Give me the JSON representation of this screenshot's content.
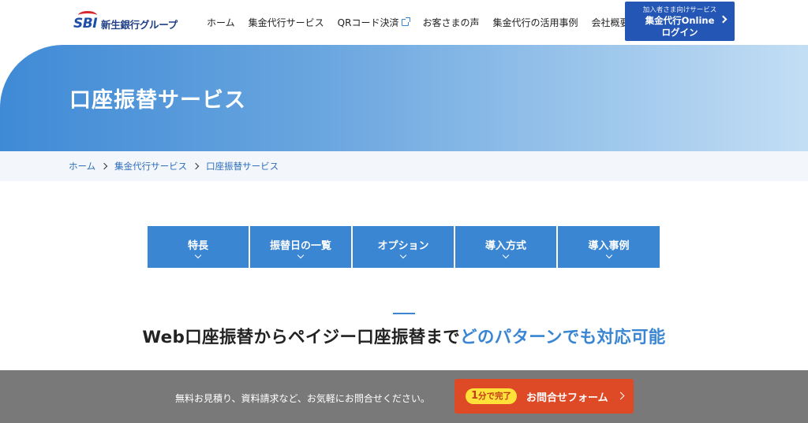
{
  "header": {
    "logo_mark": "SBI",
    "logo_text": "新生銀行グループ",
    "nav": [
      {
        "label": "ホーム"
      },
      {
        "label": "集金代行サービス"
      },
      {
        "label": "QRコード決済",
        "icon": "external-link-icon"
      },
      {
        "label": "お客さまの声"
      },
      {
        "label": "集金代行の活用事例"
      },
      {
        "label": "会社概要"
      }
    ],
    "login": {
      "sub_label": "加入者さま向けサービス",
      "line1": "集金代行Online",
      "line2": "ログイン"
    }
  },
  "hero": {
    "title": "口座振替サービス"
  },
  "breadcrumb": [
    "ホーム",
    "集金代行サービス",
    "口座振替サービス"
  ],
  "tabs": [
    {
      "label": "特長"
    },
    {
      "label": "振替日の一覧"
    },
    {
      "label": "オプション"
    },
    {
      "label": "導入方式"
    },
    {
      "label": "導入事例"
    }
  ],
  "section": {
    "title_plain": "Web口座振替からペイジー口座振替まで",
    "title_accent": "どのパターンでも対応可能"
  },
  "cta": {
    "text": "無料お見積り、資料請求など、お気軽にお問合せください。",
    "badge_num": "1",
    "badge_text": "分で完了",
    "button_label": "お問合せフォーム"
  },
  "colors": {
    "brand_blue": "#2456b5",
    "accent_blue": "#3b86d2",
    "cta_orange": "#de4a26",
    "badge_yellow": "#ffe13a"
  }
}
